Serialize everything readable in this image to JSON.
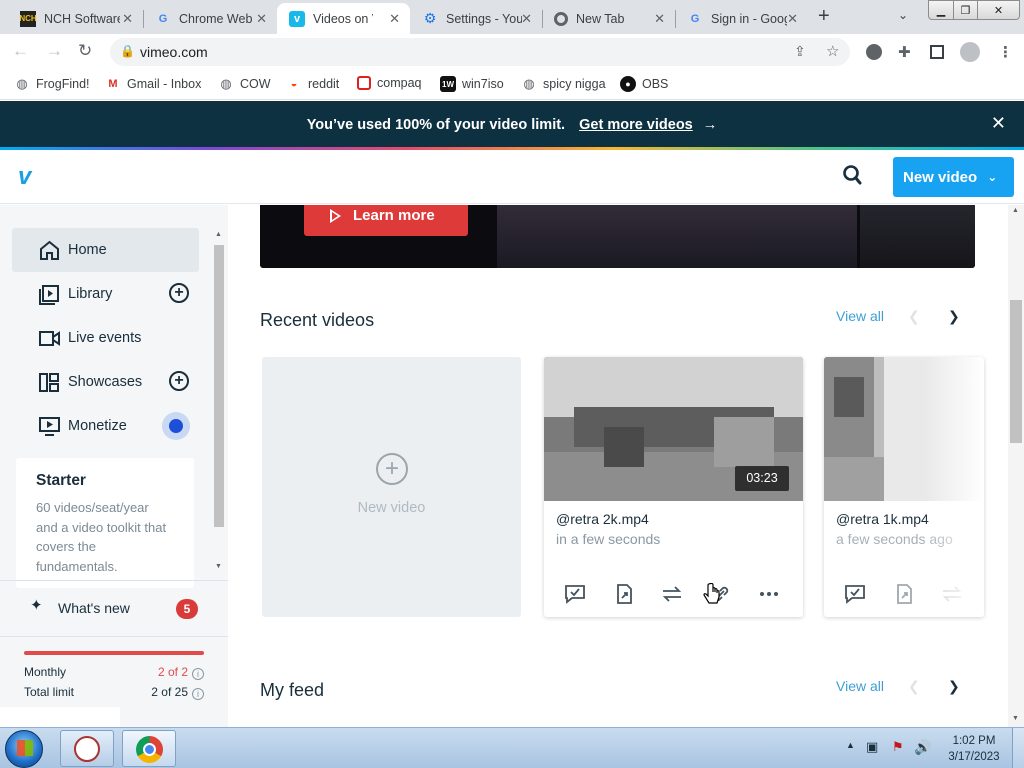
{
  "browser": {
    "tabs": [
      {
        "title": "NCH Software",
        "icon": "nch-icon"
      },
      {
        "title": "Chrome Web Store",
        "icon": "google-icon"
      },
      {
        "title": "Videos on Vimeo",
        "icon": "vimeo-icon",
        "active": true
      },
      {
        "title": "Settings - YouTube",
        "icon": "gear-icon"
      },
      {
        "title": "New Tab",
        "icon": "chrome-icon"
      },
      {
        "title": "Sign in - Google",
        "icon": "google-icon"
      }
    ],
    "url": "vimeo.com",
    "bookmarks": [
      {
        "label": "FrogFind!",
        "icon": "globe-icon"
      },
      {
        "label": "Gmail - Inbox",
        "icon": "gmail-icon"
      },
      {
        "label": "COW",
        "icon": "globe-icon"
      },
      {
        "label": "reddit",
        "icon": "reddit-icon"
      },
      {
        "label": "compaq",
        "icon": "compaq-icon"
      },
      {
        "label": "win7iso",
        "icon": "win7iso-icon"
      },
      {
        "label": "spicy nigga",
        "icon": "globe-icon"
      },
      {
        "label": "OBS",
        "icon": "github-icon"
      }
    ]
  },
  "banner": {
    "text": "You’ve used 100% of your video limit.",
    "link": "Get more videos",
    "arrow": "→",
    "close": "✕"
  },
  "header": {
    "logo": "v",
    "new_video_label": "New video"
  },
  "sidebar": {
    "items": [
      {
        "label": "Home",
        "icon": "home-icon",
        "active": true
      },
      {
        "label": "Library",
        "icon": "library-icon",
        "plus": true
      },
      {
        "label": "Live events",
        "icon": "camera-icon"
      },
      {
        "label": "Showcases",
        "icon": "showcase-icon",
        "plus": true
      },
      {
        "label": "Monetize",
        "icon": "monitor-icon",
        "dot": true
      }
    ],
    "plan": {
      "title": "Starter",
      "description": "60 videos/seat/year and a video toolkit that covers the fundamentals."
    },
    "whats_new": {
      "label": "What's new",
      "count": "5"
    },
    "quota": {
      "monthly_label": "Monthly",
      "monthly_value": "2 of 2",
      "monthly_fraction": 1.0,
      "total_label": "Total limit",
      "total_value": "2 of 25"
    }
  },
  "main": {
    "promo": {
      "button": "Learn more"
    },
    "recent": {
      "title": "Recent videos",
      "view_all": "View all",
      "new_video_label": "New video",
      "videos": [
        {
          "name": "@retra 2k.mp4",
          "time": "in a few seconds",
          "duration": "03:23"
        },
        {
          "name": "@retra 1k.mp4",
          "time": "a few seconds ago"
        }
      ]
    },
    "feed": {
      "title": "My feed",
      "view_all": "View all"
    }
  },
  "taskbar": {
    "time": "1:02 PM",
    "date": "3/17/2023"
  },
  "colors": {
    "accent": "#17a2f2",
    "banner": "#0d3140",
    "danger": "#de3a3a"
  }
}
